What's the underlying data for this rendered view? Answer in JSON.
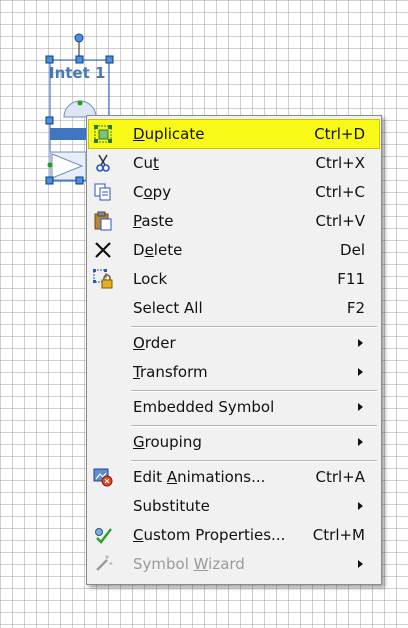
{
  "canvas": {
    "symbol_label": "Intet 1"
  },
  "colors": {
    "highlight": "#fafa18",
    "selection_handle": "#1f5fc6",
    "symbol_blue": "#4a78b0"
  },
  "context_menu": {
    "items": [
      {
        "id": "duplicate",
        "pre": "",
        "ul": "D",
        "post": "uplicate",
        "shortcut": "Ctrl+D",
        "icon": "duplicate-icon",
        "highlighted": true
      },
      {
        "id": "cut",
        "pre": "Cu",
        "ul": "t",
        "post": "",
        "shortcut": "Ctrl+X",
        "icon": "scissors-icon"
      },
      {
        "id": "copy",
        "pre": "C",
        "ul": "o",
        "post": "py",
        "shortcut": "Ctrl+C",
        "icon": "copy-icon"
      },
      {
        "id": "paste",
        "pre": "",
        "ul": "P",
        "post": "aste",
        "shortcut": "Ctrl+V",
        "icon": "clipboard-icon"
      },
      {
        "id": "delete",
        "pre": "D",
        "ul": "e",
        "post": "lete",
        "shortcut": "Del",
        "icon": "delete-x-icon"
      },
      {
        "id": "lock",
        "pre": "Lock",
        "ul": "",
        "post": "",
        "shortcut": "F11",
        "icon": "lock-icon"
      },
      {
        "id": "select-all",
        "pre": "Select All",
        "ul": "",
        "post": "",
        "shortcut": "F2",
        "icon": ""
      },
      {
        "id": "order",
        "pre": "",
        "ul": "O",
        "post": "rder",
        "submenu": true
      },
      {
        "id": "transform",
        "pre": "",
        "ul": "T",
        "post": "ransform",
        "submenu": true
      },
      {
        "id": "embedded-symbol",
        "pre": "Embedded Symbol",
        "ul": "",
        "post": "",
        "submenu": true
      },
      {
        "id": "grouping",
        "pre": "",
        "ul": "G",
        "post": "rouping",
        "submenu": true
      },
      {
        "id": "edit-animations",
        "pre": "Edit ",
        "ul": "A",
        "post": "nimations...",
        "shortcut": "Ctrl+A",
        "icon": "animation-icon"
      },
      {
        "id": "substitute",
        "pre": "Substitute",
        "ul": "",
        "post": "",
        "submenu": true
      },
      {
        "id": "custom-properties",
        "pre": "",
        "ul": "C",
        "post": "ustom Properties...",
        "shortcut": "Ctrl+M",
        "icon": "custom-properties-icon"
      },
      {
        "id": "symbol-wizard",
        "pre": "Symbol ",
        "ul": "W",
        "post": "izard",
        "submenu": true,
        "disabled": true,
        "icon": "wand-icon"
      }
    ]
  }
}
